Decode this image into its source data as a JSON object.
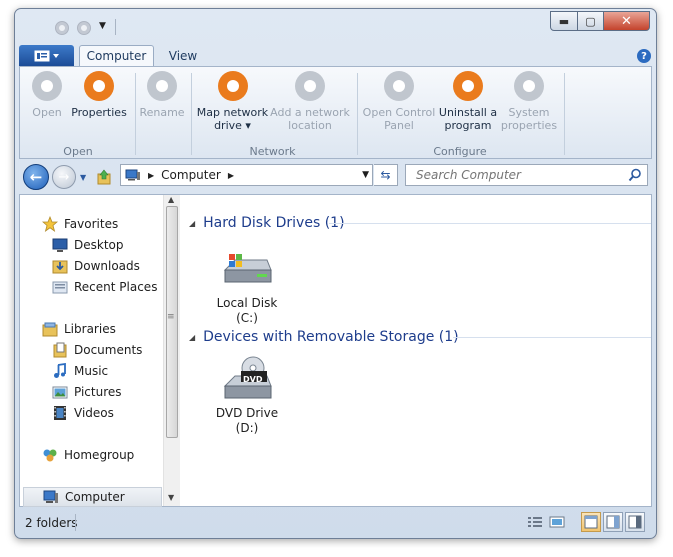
{
  "titlebar": {
    "controls": {
      "minimize": "▬",
      "maximize": "▢",
      "close": "✕"
    }
  },
  "ribbon_tabs": {
    "tabs": [
      {
        "label": "Computer",
        "active": true
      },
      {
        "label": "View",
        "active": false
      }
    ],
    "help": "?"
  },
  "ribbon": {
    "groups": [
      {
        "label": "Open",
        "buttons": [
          {
            "label": "Open",
            "enabled": false
          },
          {
            "label": "Properties",
            "enabled": true
          }
        ]
      },
      {
        "label": "",
        "buttons": [
          {
            "label": "Rename",
            "enabled": false
          }
        ]
      },
      {
        "label": "Network",
        "buttons": [
          {
            "label": "Map network drive ▾",
            "enabled": true
          },
          {
            "label": "Add a network location",
            "enabled": false
          }
        ]
      },
      {
        "label": "Configure",
        "buttons": [
          {
            "label": "Open Control Panel",
            "enabled": false
          },
          {
            "label": "Uninstall a program",
            "enabled": true
          },
          {
            "label": "System properties",
            "enabled": false
          }
        ]
      }
    ]
  },
  "address": {
    "segments": [
      "Computer"
    ],
    "search_placeholder": "Search Computer"
  },
  "nav_pane": {
    "favorites": {
      "label": "Favorites",
      "items": [
        "Desktop",
        "Downloads",
        "Recent Places"
      ]
    },
    "libraries": {
      "label": "Libraries",
      "items": [
        "Documents",
        "Music",
        "Pictures",
        "Videos"
      ]
    },
    "homegroup": "Homegroup",
    "computer": "Computer"
  },
  "main": {
    "groups": [
      {
        "header": "Hard Disk Drives (1)",
        "items": [
          {
            "name": "Local Disk",
            "letter": "(C:)"
          }
        ]
      },
      {
        "header": "Devices with Removable Storage (1)",
        "items": [
          {
            "name": "DVD Drive",
            "letter": "(D:)",
            "badge": "DVD"
          }
        ]
      }
    ]
  },
  "status": {
    "text": "2 folders"
  },
  "colors": {
    "accent": "#1e5fb9",
    "ribbon_button": "#ea7b1d",
    "group_header": "#1e3d8c"
  }
}
